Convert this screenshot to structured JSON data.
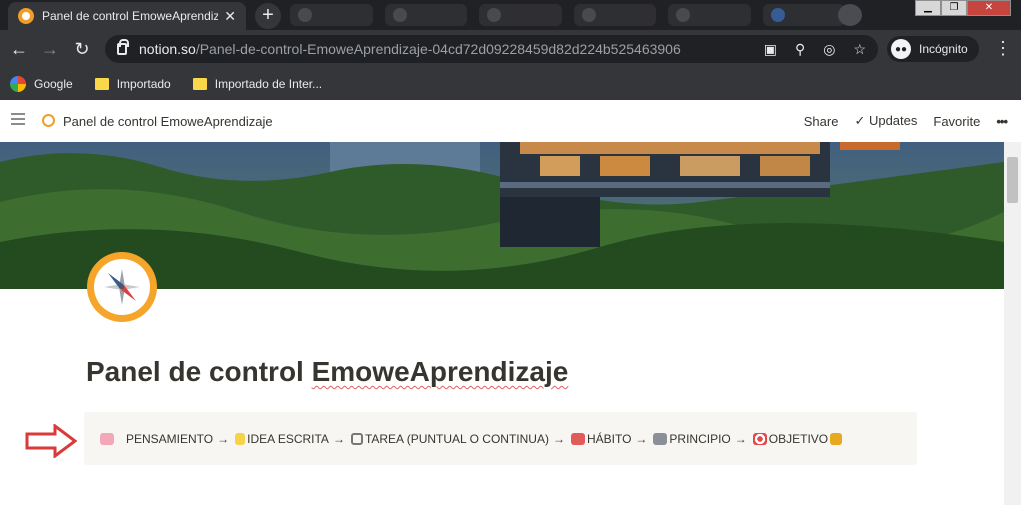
{
  "browser": {
    "active_tab_title": "Panel de control EmoweAprendizaje",
    "url_host": "notion.so",
    "url_path": "/Panel-de-control-EmoweAprendizaje-04cd72d09228459d82d224b525463906",
    "incognito_label": "Incógnito",
    "bookmarks": [
      "Google",
      "Importado",
      "Importado de Inter..."
    ]
  },
  "notion": {
    "breadcrumb": "Panel de control EmoweAprendizaje",
    "share": "Share",
    "updates": "Updates",
    "favorite": "Favorite",
    "more": "•••"
  },
  "page": {
    "title_prefix": "Panel de control ",
    "title_word": "EmoweAprendizaje",
    "callout": {
      "pensamiento": "PENSAMIENTO",
      "idea": "IDEA ESCRITA",
      "tarea": "TAREA (PUNTUAL O CONTINUA)",
      "habito": "HÁBITO",
      "principio": "PRINCIPIO",
      "objetivo": "OBJETIVO",
      "arrow": "→"
    }
  },
  "colors": {
    "accent_orange": "#f4a52a",
    "arrow_red": "#d93a3a",
    "callout_bg": "#f7f6f3"
  }
}
